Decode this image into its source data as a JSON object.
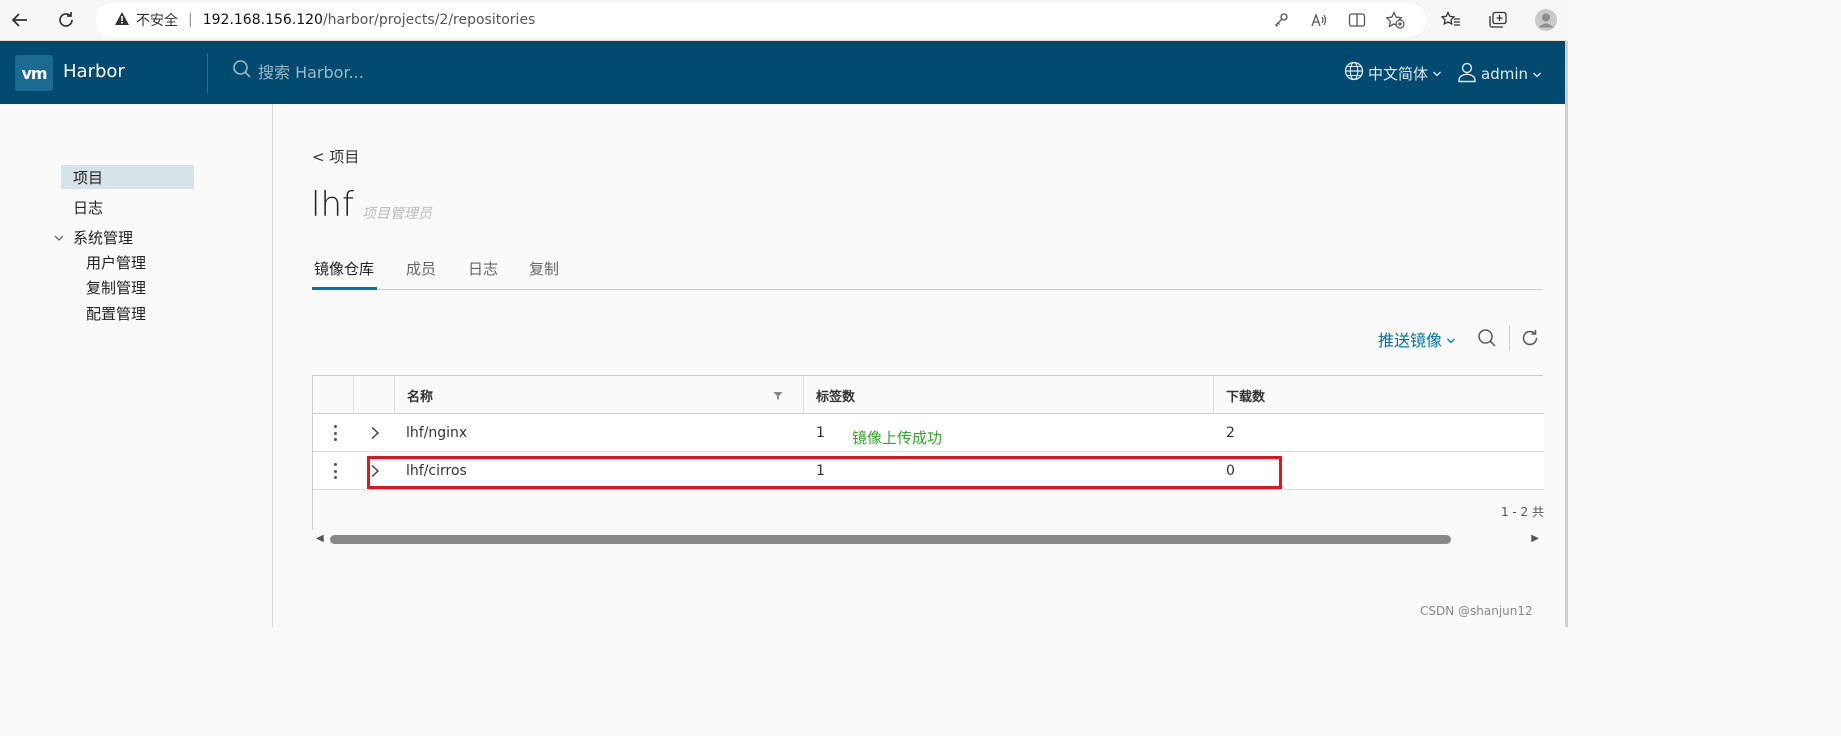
{
  "browser": {
    "security_label": "不安全",
    "url_host": "192.168.156.120",
    "url_path": "/harbor/projects/2/repositories"
  },
  "header": {
    "logo_text": "vm",
    "brand": "Harbor",
    "search_placeholder": "搜索 Harbor...",
    "language": "中文简体",
    "user": "admin"
  },
  "sidebar": {
    "items": [
      {
        "label": "项目"
      },
      {
        "label": "日志"
      },
      {
        "label": "系统管理"
      }
    ],
    "admin_children": [
      {
        "label": "用户管理"
      },
      {
        "label": "复制管理"
      },
      {
        "label": "配置管理"
      }
    ]
  },
  "project": {
    "breadcrumb": "< 项目",
    "name": "lhf",
    "role": "项目管理员"
  },
  "tabs": [
    {
      "label": "镜像仓库"
    },
    {
      "label": "成员"
    },
    {
      "label": "日志"
    },
    {
      "label": "复制"
    }
  ],
  "toolbar": {
    "push_image": "推送镜像"
  },
  "grid": {
    "columns": [
      "名称",
      "标签数",
      "下载数"
    ],
    "rows": [
      {
        "name": "lhf/nginx",
        "tags": "1",
        "pulls": "2"
      },
      {
        "name": "lhf/cirros",
        "tags": "1",
        "pulls": "0"
      }
    ],
    "pagination": "1 - 2 共"
  },
  "annotation": "镜像上传成功",
  "watermark": "CSDN @shanjun12",
  "colors": {
    "header_bg": "#004a70",
    "accent": "#0072a3",
    "annotation": "#2fa829",
    "highlight_border": "#e0141e"
  }
}
